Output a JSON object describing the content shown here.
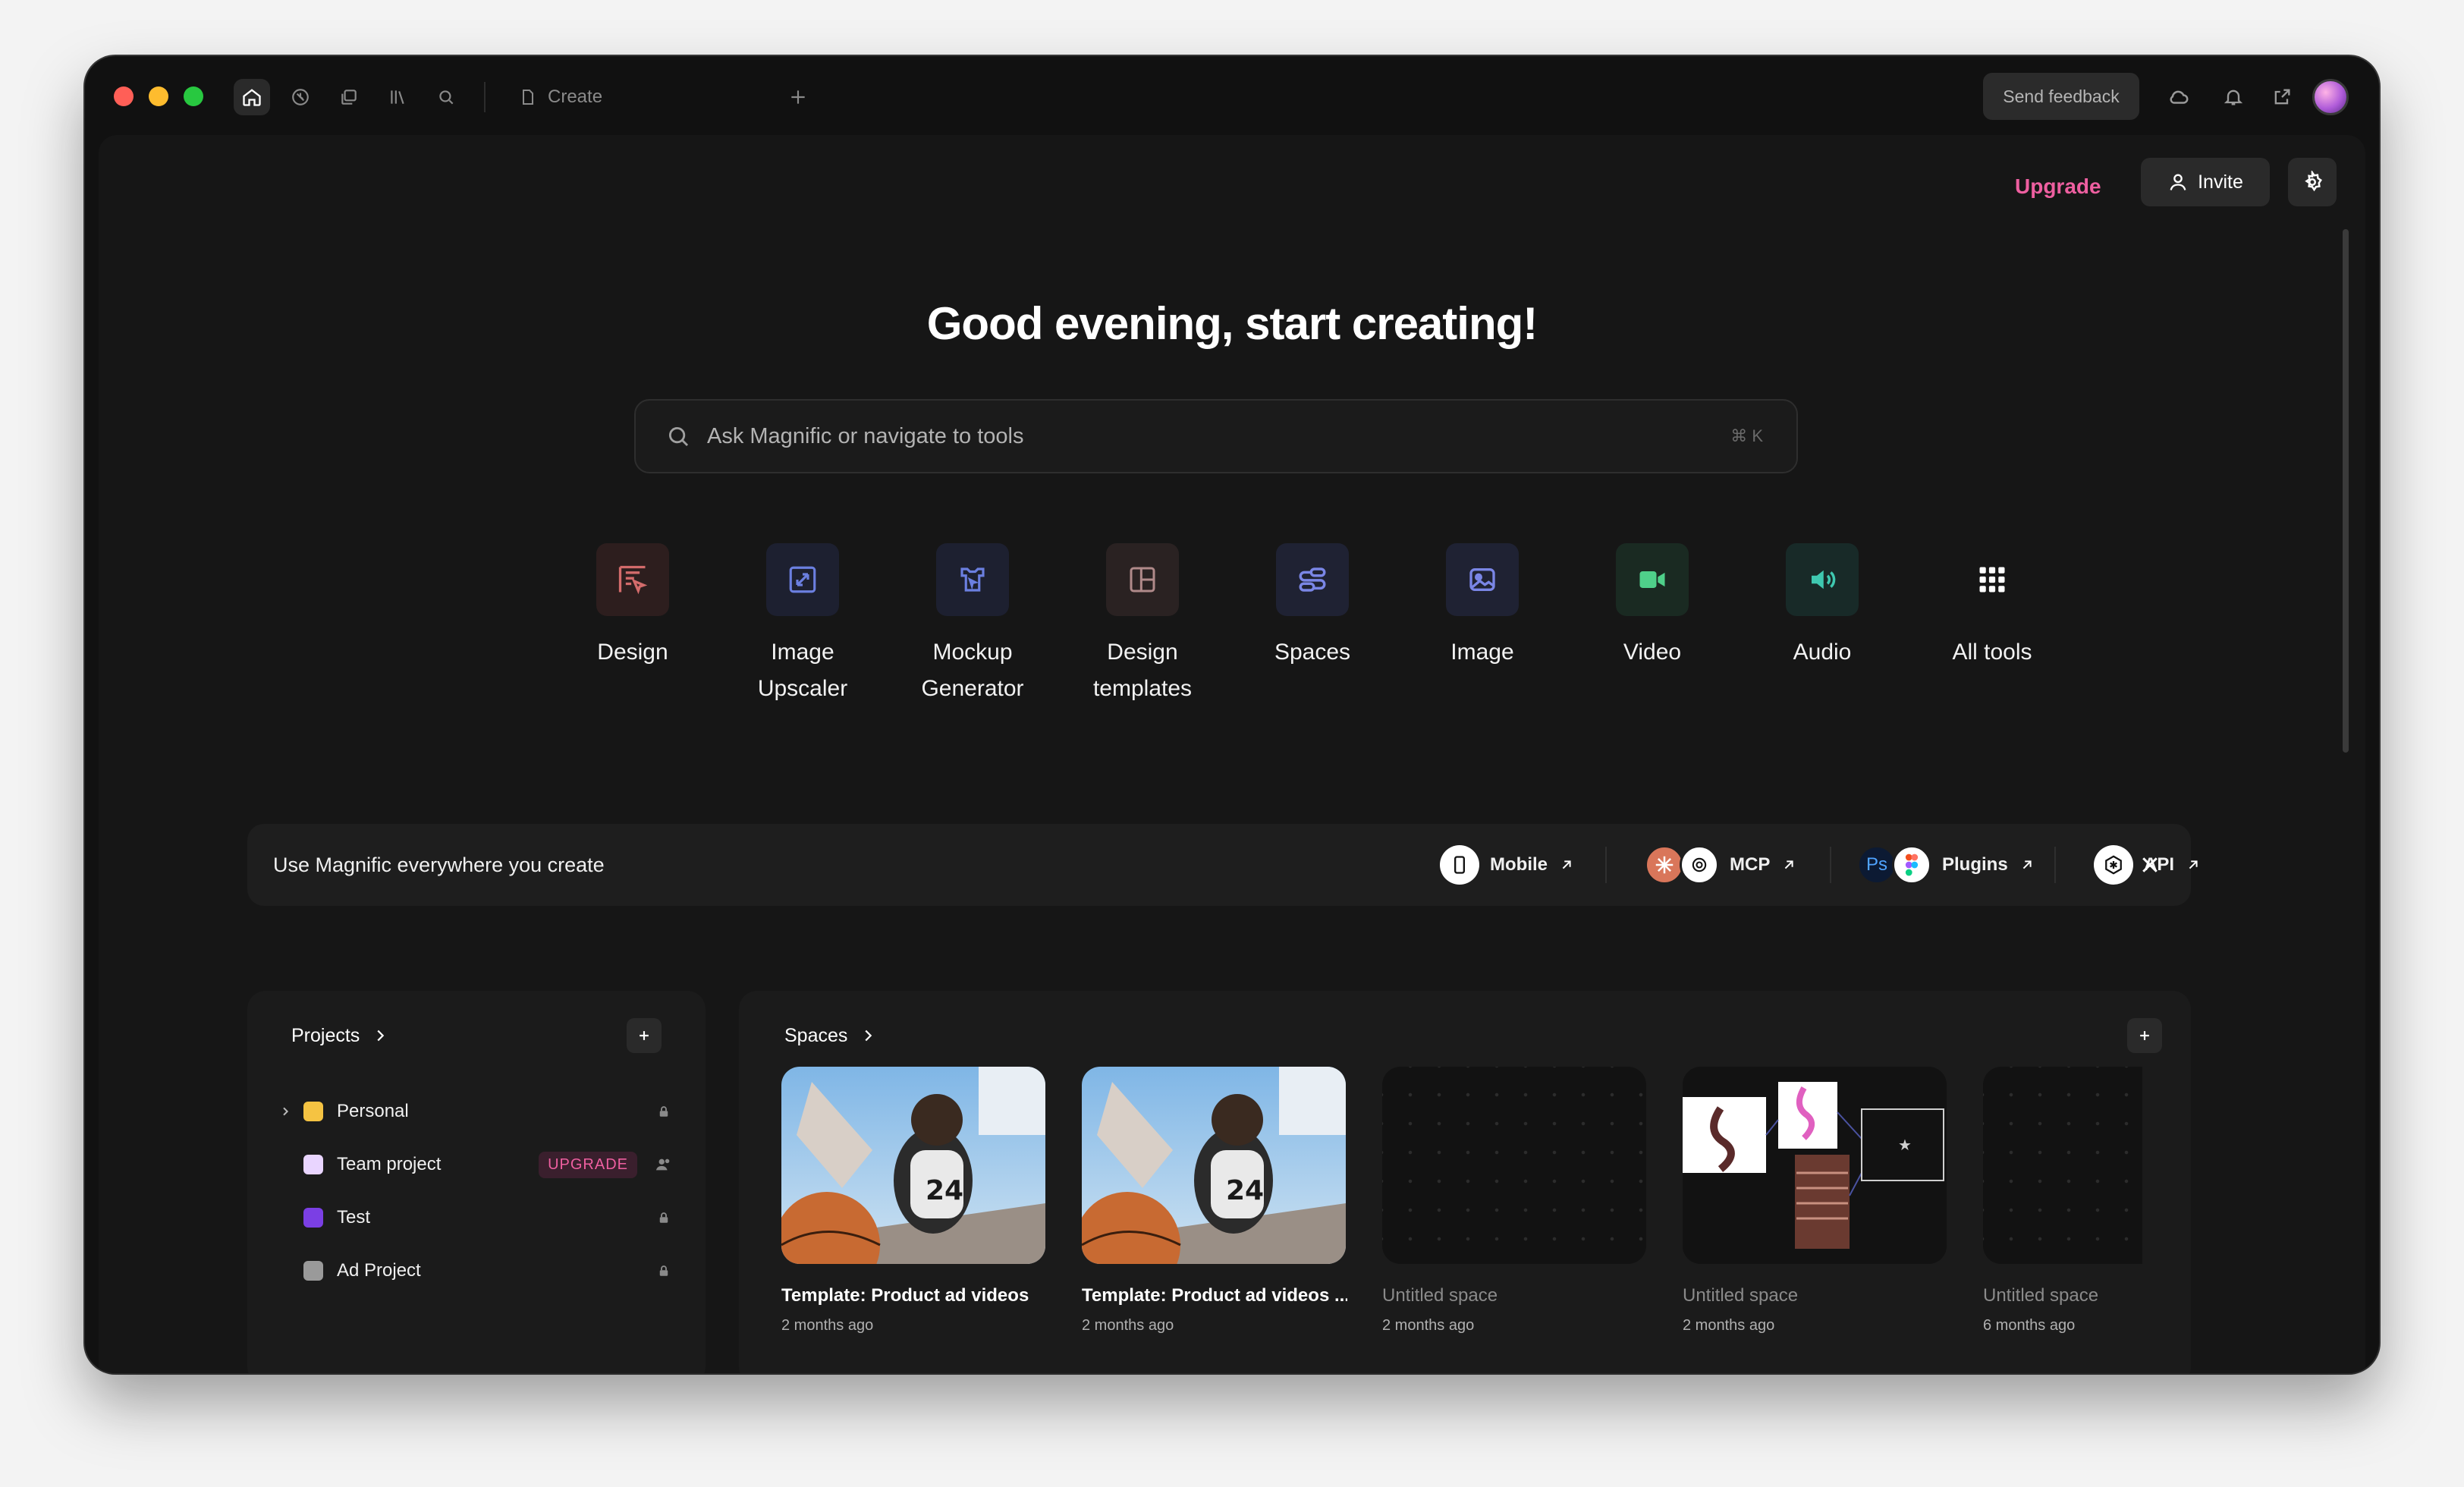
{
  "tabbar": {
    "tab_label": "Create",
    "feedback_label": "Send feedback"
  },
  "header": {
    "upgrade_label": "Upgrade",
    "invite_label": "Invite"
  },
  "hero": {
    "greeting": "Good evening, start creating!",
    "search_placeholder": "Ask Magnific or navigate to tools",
    "shortcut": "⌘ K"
  },
  "tools": [
    {
      "label": "Design",
      "icon": "design-icon",
      "color": "#d36b6b"
    },
    {
      "label": "Image\nUpscaler",
      "icon": "upscaler-icon",
      "color": "#6b7fe0"
    },
    {
      "label": "Mockup\nGenerator",
      "icon": "mockup-icon",
      "color": "#6b7fe0"
    },
    {
      "label": "Design\ntemplates",
      "icon": "templates-icon",
      "color": "#b08a8a"
    },
    {
      "label": "Spaces",
      "icon": "spaces-icon",
      "color": "#7a86e6"
    },
    {
      "label": "Image",
      "icon": "image-icon",
      "color": "#7a86e6"
    },
    {
      "label": "Video",
      "icon": "video-icon",
      "color": "#4fd08a"
    },
    {
      "label": "Audio",
      "icon": "audio-icon",
      "color": "#3fc8b0"
    },
    {
      "label": "All tools",
      "icon": "grid-icon",
      "color": "#ffffff"
    }
  ],
  "banner": {
    "title": "Use Magnific everywhere you create",
    "items": [
      {
        "label": "Mobile"
      },
      {
        "label": "MCP"
      },
      {
        "label": "Plugins"
      },
      {
        "label": "API"
      }
    ],
    "ps_text": "Ps"
  },
  "projects": {
    "title": "Projects",
    "upgrade_badge": "UPGRADE",
    "items": [
      {
        "name": "Personal",
        "color": "#f5c342"
      },
      {
        "name": "Team project",
        "color": "#e9d5ff"
      },
      {
        "name": "Test",
        "color": "#7b3fe4"
      },
      {
        "name": "Ad Project",
        "color": "#9a9a9a"
      }
    ]
  },
  "spaces": {
    "title": "Spaces",
    "items": [
      {
        "title": "Template: Product ad videos",
        "date": "2 months ago"
      },
      {
        "title": "Template: Product ad videos ...",
        "date": "2 months ago"
      },
      {
        "title": "Untitled space",
        "date": "2 months ago"
      },
      {
        "title": "Untitled space",
        "date": "2 months ago"
      },
      {
        "title": "Untitled space",
        "date": "6 months ago"
      }
    ]
  }
}
